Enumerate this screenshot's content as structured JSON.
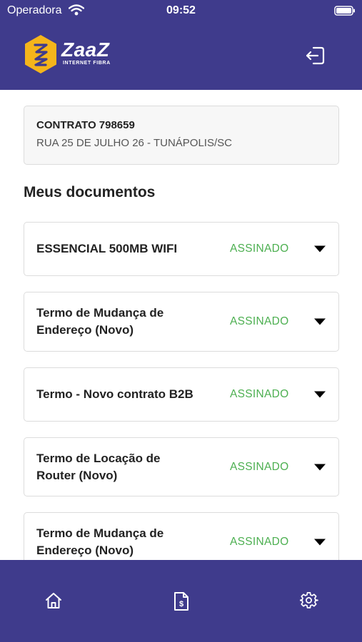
{
  "status_bar": {
    "carrier": "Operadora",
    "time": "09:52"
  },
  "header": {
    "logo_text": "ZaaZ",
    "logo_subtitle": "INTERNET FIBRA",
    "logout_icon": "logout-icon"
  },
  "contract": {
    "title": "CONTRATO 798659",
    "address": "RUA 25 DE JULHO 26 - TUNÁPOLIS/SC"
  },
  "documents_section": {
    "title": "Meus documentos"
  },
  "documents": [
    {
      "name": "ESSENCIAL 500MB WIFI",
      "status": "ASSINADO"
    },
    {
      "name": "Termo de Mudança de Endereço (Novo)",
      "status": "ASSINADO"
    },
    {
      "name": "Termo - Novo contrato B2B",
      "status": "ASSINADO"
    },
    {
      "name": "Termo de Locação de Router (Novo)",
      "status": "ASSINADO"
    },
    {
      "name": "Termo de Mudança de Endereço (Novo)",
      "status": "ASSINADO"
    }
  ],
  "tabbar": {
    "items": [
      {
        "icon": "home-icon"
      },
      {
        "icon": "invoice-icon"
      },
      {
        "icon": "gear-icon"
      }
    ]
  },
  "colors": {
    "brand": "#3f3b8c",
    "logo_yellow": "#f5b51b",
    "status_green": "#4caf50"
  }
}
